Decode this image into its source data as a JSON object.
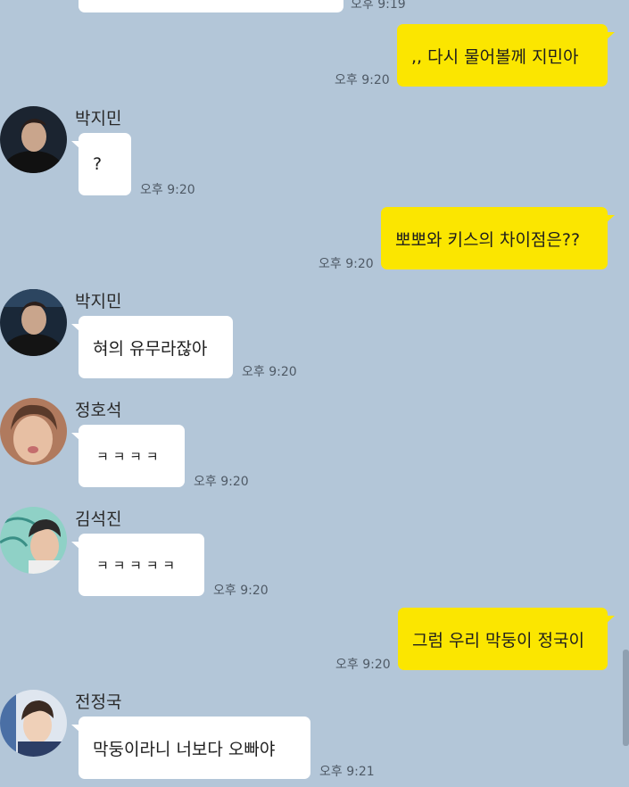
{
  "messages": [
    {
      "text": "",
      "time": "오후 9:19"
    },
    {
      "text": ",, 다시 물어볼께 지민아",
      "time": "오후 9:20"
    },
    {
      "sender": "박지민",
      "text": "?",
      "time": "오후 9:20"
    },
    {
      "text": "뽀뽀와 키스의 차이점은??",
      "time": "오후 9:20"
    },
    {
      "sender": "박지민",
      "text": "혀의 유무라잖아",
      "time": "오후 9:20"
    },
    {
      "sender": "정호석",
      "text": "ㅋ ㅋ ㅋ ㅋ",
      "time": "오후 9:20"
    },
    {
      "sender": "김석진",
      "text": "ㅋ ㅋ ㅋ ㅋ ㅋ",
      "time": "오후 9:20"
    },
    {
      "text": "그럼 우리 막둥이 정국이",
      "time": "오후 9:20"
    },
    {
      "sender": "전정국",
      "text": "막둥이라니 너보다 오빠야",
      "time": "오후 9:21"
    }
  ],
  "colors": {
    "background": "#b3c6d8",
    "outgoing_bubble": "#fbe600",
    "incoming_bubble": "#ffffff"
  },
  "icons": [
    "avatar-jimin",
    "avatar-hoseok",
    "avatar-seokjin",
    "avatar-jungkook"
  ]
}
